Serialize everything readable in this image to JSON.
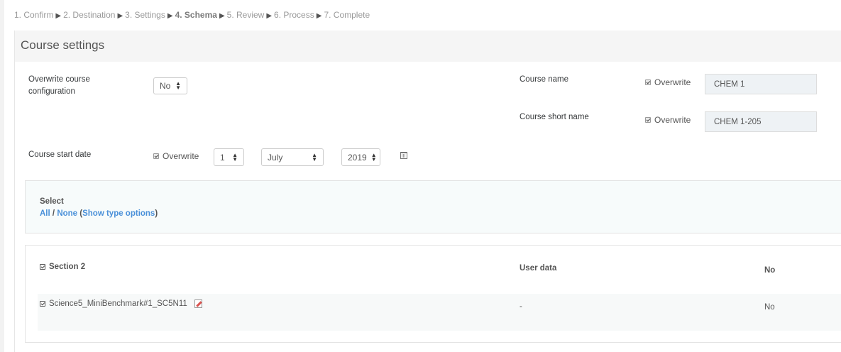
{
  "breadcrumb": {
    "steps": [
      "1. Confirm",
      "2. Destination",
      "3. Settings",
      "4. Schema",
      "5. Review",
      "6. Process",
      "7. Complete"
    ],
    "separator": "▶"
  },
  "card": {
    "title": "Course settings"
  },
  "overwrite_config": {
    "label": "Overwrite course configuration",
    "value": "No"
  },
  "course_name": {
    "label": "Course name",
    "overwrite_label": "Overwrite",
    "overwrite_checked": true,
    "value": "CHEM 1"
  },
  "course_short_name": {
    "label": "Course short name",
    "overwrite_label": "Overwrite",
    "overwrite_checked": true,
    "value": "CHEM 1-205"
  },
  "start_date": {
    "label": "Course start date",
    "overwrite_label": "Overwrite",
    "overwrite_checked": true,
    "day": "1",
    "month": "July",
    "year": "2019",
    "calendar_icon": "calendar-icon"
  },
  "select_panel": {
    "title": "Select",
    "all": "All",
    "slash": "/",
    "none": "None",
    "open_paren": "(",
    "show_type_options": "Show type options",
    "close_paren": ")"
  },
  "section": {
    "name": "Section 2",
    "checked": true,
    "user_data_header": "User data",
    "value_header": "No",
    "items": [
      {
        "name": "Science5_MiniBenchmark#1_SC5N11",
        "checked": true,
        "icon": "edit-icon",
        "user_data": "-",
        "value": "No"
      }
    ]
  },
  "colors": {
    "link": "#4a90d9",
    "header_bg": "#f5f5f5",
    "input_bg": "#eef2f5"
  }
}
